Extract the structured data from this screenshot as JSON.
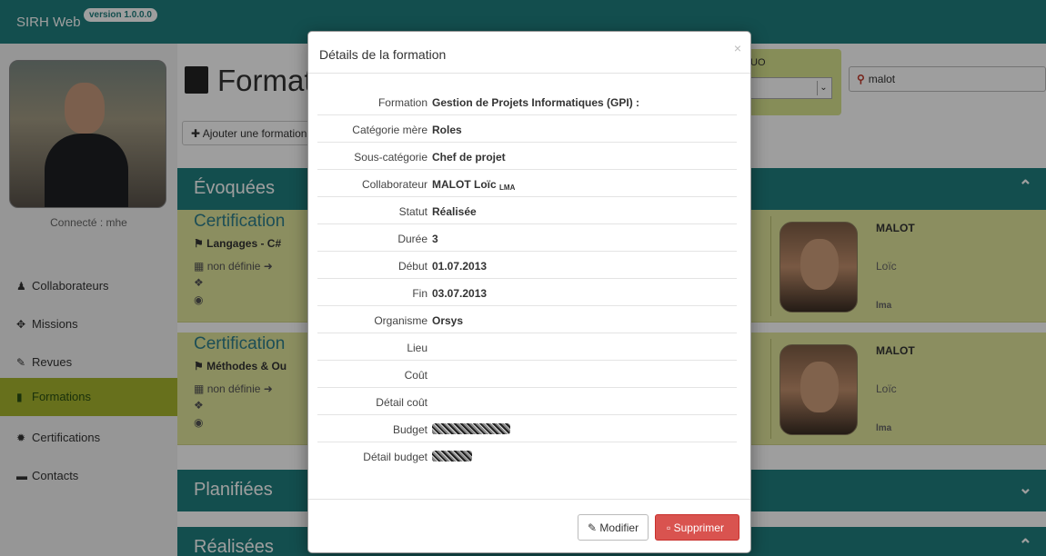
{
  "navbar": {
    "brand": "SIRH Web",
    "version": "version 1.0.0.0"
  },
  "sidebar": {
    "connected": "Connecté : mhe",
    "items": [
      {
        "label": "Collaborateurs",
        "icon": "user-icon"
      },
      {
        "label": "Missions",
        "icon": "move-icon"
      },
      {
        "label": "Revues",
        "icon": "edit-icon"
      },
      {
        "label": "Formations",
        "icon": "book-icon"
      },
      {
        "label": "Certifications",
        "icon": "certificate-icon"
      },
      {
        "label": "Contacts",
        "icon": "contact-icon"
      }
    ]
  },
  "main": {
    "title": "Formati",
    "add_button": "Ajouter une formation",
    "filter_label": "UO",
    "search_value": "malot",
    "sections": {
      "evoquees": "Évoquées",
      "planifiees": "Planifiées",
      "realisees": "Réalisées"
    },
    "cards": [
      {
        "title": "Certification",
        "subtitle": "Langages - C#",
        "date": "non définie",
        "name": "MALOT",
        "first": "Loïc",
        "tri": "lma"
      },
      {
        "title": "Certification",
        "subtitle": "Méthodes & Ou",
        "date": "non définie",
        "name": "MALOT",
        "first": "Loïc",
        "tri": "lma"
      }
    ]
  },
  "modal": {
    "title": "Détails de la formation",
    "close": "×",
    "rows": [
      {
        "label": "Formation",
        "value": "Gestion de Projets Informatiques (GPI) :"
      },
      {
        "label": "Catégorie mère",
        "value": "Roles"
      },
      {
        "label": "Sous-catégorie",
        "value": "Chef de projet"
      },
      {
        "label": "Collaborateur",
        "value": "MALOT Loïc",
        "tag": "LMA"
      },
      {
        "label": "Statut",
        "value": "Réalisée"
      },
      {
        "label": "Durée",
        "value": "3"
      },
      {
        "label": "Début",
        "value": "01.07.2013"
      },
      {
        "label": "Fin",
        "value": "03.07.2013"
      },
      {
        "label": "Organisme",
        "value": "Orsys"
      },
      {
        "label": "Lieu",
        "value": ""
      },
      {
        "label": "Coût",
        "value": ""
      },
      {
        "label": "Détail coût",
        "value": ""
      },
      {
        "label": "Budget",
        "value": ""
      },
      {
        "label": "Détail budget",
        "value": ""
      }
    ],
    "modify_button": "Modifier",
    "delete_button": "Supprimer"
  }
}
